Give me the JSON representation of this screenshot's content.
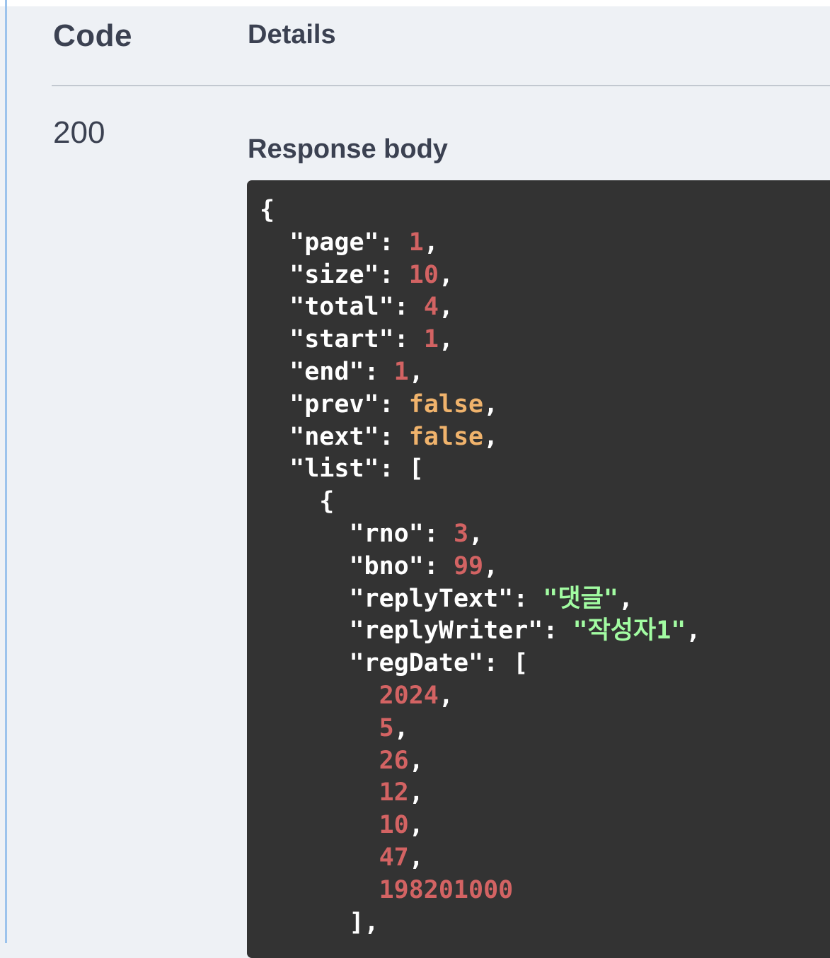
{
  "table": {
    "header_code": "Code",
    "header_details": "Details",
    "status_code": "200",
    "response_label": "Response body"
  },
  "colors": {
    "background": "#eef1f5",
    "code_background": "#333333",
    "number": "#d36363",
    "boolean": "#f0b36c",
    "string": "#a2fca2",
    "text": "#3b4151"
  },
  "response_body": {
    "lines": [
      {
        "indent": 0,
        "tokens": [
          {
            "t": "{",
            "k": "punc"
          }
        ]
      },
      {
        "indent": 2,
        "tokens": [
          {
            "t": "\"page\"",
            "k": "key"
          },
          {
            "t": ": ",
            "k": "punc"
          },
          {
            "t": "1",
            "k": "num"
          },
          {
            "t": ",",
            "k": "punc"
          }
        ]
      },
      {
        "indent": 2,
        "tokens": [
          {
            "t": "\"size\"",
            "k": "key"
          },
          {
            "t": ": ",
            "k": "punc"
          },
          {
            "t": "10",
            "k": "num"
          },
          {
            "t": ",",
            "k": "punc"
          }
        ]
      },
      {
        "indent": 2,
        "tokens": [
          {
            "t": "\"total\"",
            "k": "key"
          },
          {
            "t": ": ",
            "k": "punc"
          },
          {
            "t": "4",
            "k": "num"
          },
          {
            "t": ",",
            "k": "punc"
          }
        ]
      },
      {
        "indent": 2,
        "tokens": [
          {
            "t": "\"start\"",
            "k": "key"
          },
          {
            "t": ": ",
            "k": "punc"
          },
          {
            "t": "1",
            "k": "num"
          },
          {
            "t": ",",
            "k": "punc"
          }
        ]
      },
      {
        "indent": 2,
        "tokens": [
          {
            "t": "\"end\"",
            "k": "key"
          },
          {
            "t": ": ",
            "k": "punc"
          },
          {
            "t": "1",
            "k": "num"
          },
          {
            "t": ",",
            "k": "punc"
          }
        ]
      },
      {
        "indent": 2,
        "tokens": [
          {
            "t": "\"prev\"",
            "k": "key"
          },
          {
            "t": ": ",
            "k": "punc"
          },
          {
            "t": "false",
            "k": "bool"
          },
          {
            "t": ",",
            "k": "punc"
          }
        ]
      },
      {
        "indent": 2,
        "tokens": [
          {
            "t": "\"next\"",
            "k": "key"
          },
          {
            "t": ": ",
            "k": "punc"
          },
          {
            "t": "false",
            "k": "bool"
          },
          {
            "t": ",",
            "k": "punc"
          }
        ]
      },
      {
        "indent": 2,
        "tokens": [
          {
            "t": "\"list\"",
            "k": "key"
          },
          {
            "t": ": [",
            "k": "punc"
          }
        ]
      },
      {
        "indent": 4,
        "tokens": [
          {
            "t": "{",
            "k": "punc"
          }
        ]
      },
      {
        "indent": 6,
        "tokens": [
          {
            "t": "\"rno\"",
            "k": "key"
          },
          {
            "t": ": ",
            "k": "punc"
          },
          {
            "t": "3",
            "k": "num"
          },
          {
            "t": ",",
            "k": "punc"
          }
        ]
      },
      {
        "indent": 6,
        "tokens": [
          {
            "t": "\"bno\"",
            "k": "key"
          },
          {
            "t": ": ",
            "k": "punc"
          },
          {
            "t": "99",
            "k": "num"
          },
          {
            "t": ",",
            "k": "punc"
          }
        ]
      },
      {
        "indent": 6,
        "tokens": [
          {
            "t": "\"replyText\"",
            "k": "key"
          },
          {
            "t": ": ",
            "k": "punc"
          },
          {
            "t": "\"댓글\"",
            "k": "str"
          },
          {
            "t": ",",
            "k": "punc"
          }
        ]
      },
      {
        "indent": 6,
        "tokens": [
          {
            "t": "\"replyWriter\"",
            "k": "key"
          },
          {
            "t": ": ",
            "k": "punc"
          },
          {
            "t": "\"작성자1\"",
            "k": "str"
          },
          {
            "t": ",",
            "k": "punc"
          }
        ]
      },
      {
        "indent": 6,
        "tokens": [
          {
            "t": "\"regDate\"",
            "k": "key"
          },
          {
            "t": ": [",
            "k": "punc"
          }
        ]
      },
      {
        "indent": 8,
        "tokens": [
          {
            "t": "2024",
            "k": "num"
          },
          {
            "t": ",",
            "k": "punc"
          }
        ]
      },
      {
        "indent": 8,
        "tokens": [
          {
            "t": "5",
            "k": "num"
          },
          {
            "t": ",",
            "k": "punc"
          }
        ]
      },
      {
        "indent": 8,
        "tokens": [
          {
            "t": "26",
            "k": "num"
          },
          {
            "t": ",",
            "k": "punc"
          }
        ]
      },
      {
        "indent": 8,
        "tokens": [
          {
            "t": "12",
            "k": "num"
          },
          {
            "t": ",",
            "k": "punc"
          }
        ]
      },
      {
        "indent": 8,
        "tokens": [
          {
            "t": "10",
            "k": "num"
          },
          {
            "t": ",",
            "k": "punc"
          }
        ]
      },
      {
        "indent": 8,
        "tokens": [
          {
            "t": "47",
            "k": "num"
          },
          {
            "t": ",",
            "k": "punc"
          }
        ]
      },
      {
        "indent": 8,
        "tokens": [
          {
            "t": "198201000",
            "k": "num"
          }
        ]
      },
      {
        "indent": 6,
        "tokens": [
          {
            "t": "],",
            "k": "punc"
          }
        ]
      }
    ]
  }
}
